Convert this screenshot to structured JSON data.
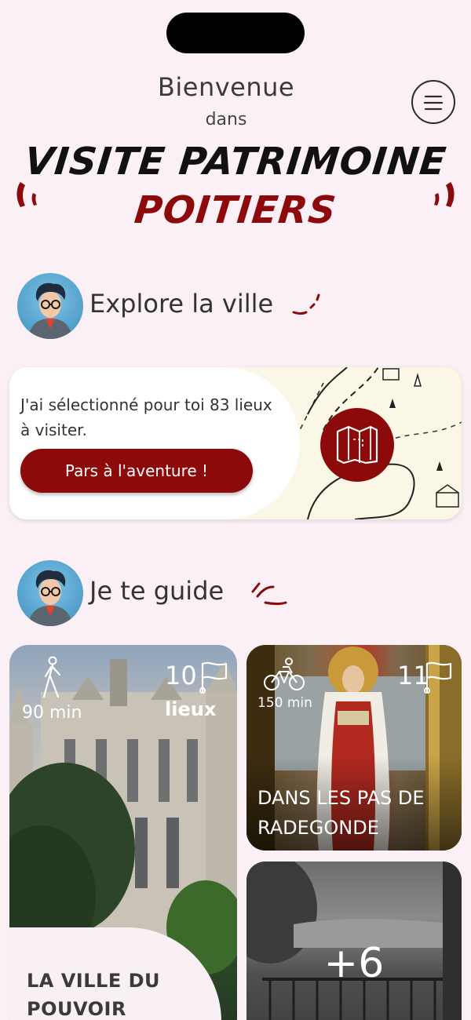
{
  "header": {
    "welcome": "Bienvenue",
    "dans": "dans",
    "brand_line1": "VISITE PATRIMOINE",
    "brand_line2": "POITIERS",
    "menu_icon": "menu-icon"
  },
  "explore": {
    "title": "Explore la ville",
    "text": "J'ai sélectionné pour toi 83 lieux à visiter.",
    "button": "Pars à l'aventure !",
    "map_icon": "map-icon"
  },
  "guide": {
    "title": "Je te guide",
    "tours": [
      {
        "mode_icon": "walk-icon",
        "duration": "90 min",
        "count": "10",
        "count_unit": "lieux",
        "name": "LA VILLE DU POUVOIR"
      },
      {
        "mode_icon": "bike-icon",
        "duration": "150 min",
        "count": "11",
        "name": "DANS LES PAS DE RADEGONDE"
      }
    ],
    "more": "+6"
  },
  "colors": {
    "accent": "#8c0a0a",
    "background": "#fbf0f6"
  }
}
